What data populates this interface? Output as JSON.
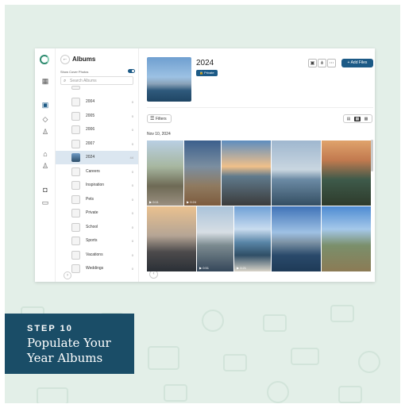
{
  "colors": {
    "accent": "#1c5a86",
    "card_bg": "#e3efe8",
    "banner": "#1a4d67"
  },
  "sidebar": {
    "title": "Albums",
    "show_cover_photos": "Show Cover Photos",
    "search_placeholder": "Search Albums",
    "albums": [
      {
        "name": "2004",
        "count": "0"
      },
      {
        "name": "2005",
        "count": "0"
      },
      {
        "name": "2006",
        "count": "0"
      },
      {
        "name": "2007",
        "count": "0"
      },
      {
        "name": "2024",
        "count": "44",
        "selected": true
      },
      {
        "name": "Careers",
        "count": "0"
      },
      {
        "name": "Inspiration",
        "count": "0"
      },
      {
        "name": "Pets",
        "count": "0"
      },
      {
        "name": "Private",
        "count": "0"
      },
      {
        "name": "School",
        "count": "0"
      },
      {
        "name": "Sports",
        "count": "0"
      },
      {
        "name": "Vacations",
        "count": "0"
      },
      {
        "name": "Weddings",
        "count": "0"
      }
    ],
    "rail_icons": [
      "photos-icon",
      "albums-icon",
      "tag-icon",
      "person-icon",
      "tree-icon",
      "people-icon",
      "camera-icon",
      "inbox-icon"
    ]
  },
  "album": {
    "title": "2024",
    "badge": "Private",
    "add_files": "Add Files",
    "filters": "Filters",
    "date_header": "Nov 10, 2024"
  },
  "photos": [
    {
      "dur": "0:11"
    },
    {
      "dur": "0:24"
    },
    {
      "dur": ""
    },
    {
      "dur": ""
    },
    {
      "dur": ""
    },
    {
      "dur": ""
    },
    {
      "dur": "0:51"
    },
    {
      "dur": "0:21"
    },
    {
      "dur": ""
    },
    {
      "dur": ""
    }
  ],
  "banner": {
    "step": "STEP 10",
    "caption": "Populate Your Year Albums"
  }
}
